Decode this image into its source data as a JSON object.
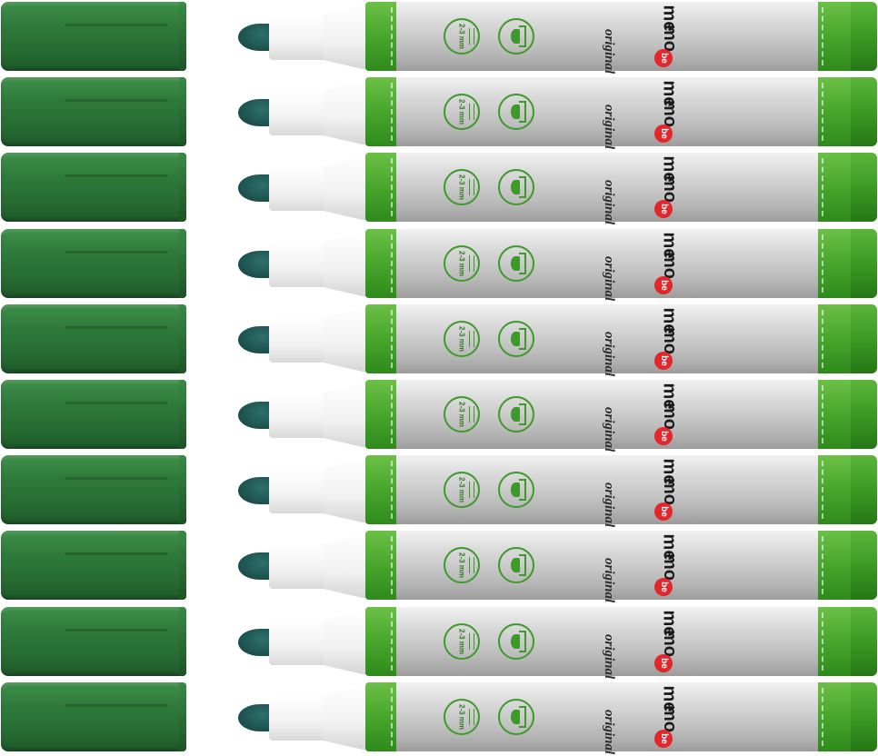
{
  "image": {
    "subject": "ten-green-markers-with-caps",
    "marker_count": 10,
    "colors": {
      "cap": "#2f7a3b",
      "tip": "#1f5653",
      "band": "#48a62c",
      "barrel": "#c7c7c7",
      "logo_badge": "#e3262a"
    }
  },
  "marker": {
    "tip_size": "2-3 mm",
    "brand_line1": "me",
    "brand_line2": "mo",
    "brand_badge": "be",
    "brand_tagline": "original"
  }
}
